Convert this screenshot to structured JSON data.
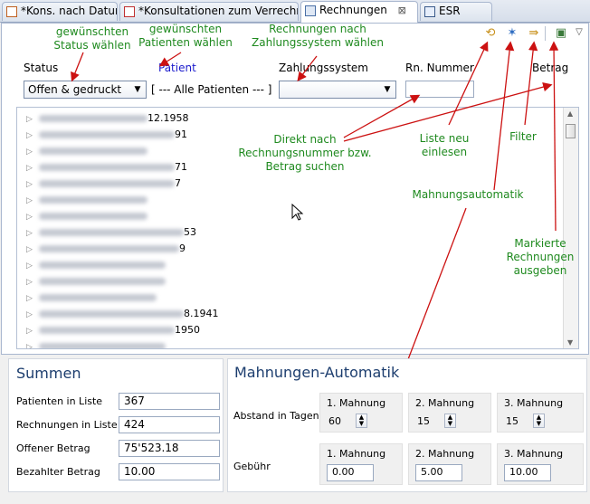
{
  "tabs": [
    {
      "label": "*Kons. nach Datum",
      "active": false
    },
    {
      "label": "*Konsultationen zum Verrechnen",
      "active": false
    },
    {
      "label": "Rechnungen",
      "active": true,
      "close": "⊠"
    },
    {
      "label": "ESR",
      "active": false
    }
  ],
  "filters": {
    "status_label": "Status",
    "status_value": "Offen & gedruckt",
    "patient_label": "Patient",
    "patient_value": "[ --- Alle Patienten --- ]",
    "zahlungssystem_label": "Zahlungssystem",
    "zahlungssystem_value": "",
    "rn_nummer_label": "Rn. Nummer",
    "rn_nummer_value": "",
    "betrag_label": "Betrag"
  },
  "tree": {
    "visible_dates": [
      "12.1958",
      "91",
      "71",
      "7",
      "53",
      "9",
      "8.1941",
      "1950"
    ]
  },
  "annotations": {
    "status": "gewünschten\nStatus wählen",
    "patient": "gewünschten\nPatienten wählen",
    "zahlungssystem": "Rechnungen nach\nZahlungssystem wählen",
    "rnsearch": "Direkt nach\nRechnungsnummer bzw.\nBetrag suchen",
    "reload": "Liste neu\neinlesen",
    "filter": "Filter",
    "mahnung": "Mahnungsautomatik",
    "ausgeben": "Markierte\nRechnungen\nausgeben"
  },
  "summen": {
    "title": "Summen",
    "rows": [
      {
        "label": "Patienten in Liste",
        "value": "367"
      },
      {
        "label": "Rechnungen in Liste",
        "value": "424"
      },
      {
        "label": "Offener Betrag",
        "value": "75'523.18"
      },
      {
        "label": "Bezahlter Betrag",
        "value": "10.00"
      }
    ]
  },
  "mahnungen": {
    "title": "Mahnungen-Automatik",
    "abstand_label": "Abstand in Tagen",
    "gebuehr_label": "Gebühr",
    "columns": [
      "1. Mahnung",
      "2. Mahnung",
      "3. Mahnung"
    ],
    "abstand_values": [
      "60",
      "15",
      "15"
    ],
    "gebuehr_values": [
      "0.00",
      "5.00",
      "10.00"
    ]
  },
  "colors": {
    "annotation": "#1f8a1f",
    "arrow": "#cc1111",
    "patient_link": "#1a1acc",
    "section_title": "#1c3d6e"
  }
}
